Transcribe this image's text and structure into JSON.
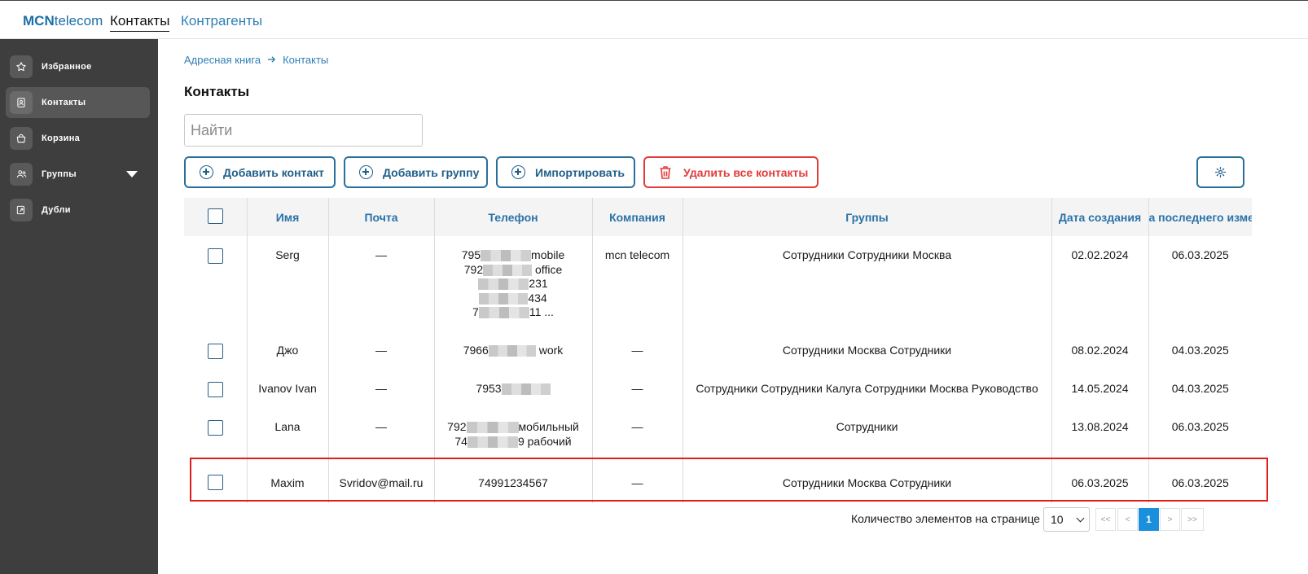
{
  "app": {
    "logo_bold": "MCN",
    "logo_rest": "telecom"
  },
  "topnav": [
    {
      "label": "Контакты",
      "active": true
    },
    {
      "label": "Контрагенты",
      "active": false
    }
  ],
  "sidebar": {
    "items": [
      {
        "label": "Избранное",
        "icon": "star-icon"
      },
      {
        "label": "Контакты",
        "icon": "contact-card-icon",
        "active": true
      },
      {
        "label": "Корзина",
        "icon": "basket-icon"
      },
      {
        "label": "Группы",
        "icon": "users-icon",
        "expandable": true
      },
      {
        "label": "Дубли",
        "icon": "duplicate-icon"
      }
    ]
  },
  "breadcrumb": [
    "Адресная книга",
    "Контакты"
  ],
  "page": {
    "title": "Контакты"
  },
  "search": {
    "placeholder": "Найти",
    "value": ""
  },
  "toolbar": {
    "add_contact": "Добавить контакт",
    "add_group": "Добавить группу",
    "import": "Импортировать",
    "delete_all": "Удалить все контакты"
  },
  "table": {
    "columns": [
      "Имя",
      "Почта",
      "Телефон",
      "Компания",
      "Группы",
      "Дата создания",
      "а последнего измен"
    ],
    "rows": [
      {
        "name": "Serg",
        "email": "—",
        "company": "mcn telecom",
        "groups": "Сотрудники Сотрудники Москва",
        "created": "02.02.2024",
        "modified": "06.03.2025",
        "phones": [
          {
            "pre": "795",
            "post": "mobile"
          },
          {
            "pre": "792",
            "post": " office"
          },
          {
            "pre": "",
            "post": "231"
          },
          {
            "pre": "",
            "post": "434"
          },
          {
            "pre": "7",
            "post": "11 ..."
          }
        ]
      },
      {
        "name": "Джо",
        "email": "—",
        "company": "—",
        "groups": "Сотрудники Москва Сотрудники",
        "created": "08.02.2024",
        "modified": "04.03.2025",
        "phones": [
          {
            "pre": "7966",
            "post": " work"
          }
        ]
      },
      {
        "name": "Ivanov Ivan",
        "email": "—",
        "company": "—",
        "groups": "Сотрудники Сотрудники Калуга Сотрудники Москва Руководство",
        "created": "14.05.2024",
        "modified": "04.03.2025",
        "phones": [
          {
            "pre": "7953",
            "post": ""
          }
        ]
      },
      {
        "name": "Lana",
        "email": "—",
        "company": "—",
        "groups": "Сотрудники",
        "created": "13.08.2024",
        "modified": "06.03.2025",
        "phones": [
          {
            "pre": "792",
            "post": "мобильный"
          },
          {
            "pre": "74",
            "post": "9 рабочий"
          }
        ]
      },
      {
        "name": "Maxim",
        "email": "Svridov@mail.ru",
        "company": "—",
        "groups": "Сотрудники Москва Сотрудники",
        "created": "06.03.2025",
        "modified": "06.03.2025",
        "phones": [
          {
            "pre": "74991234567",
            "post": ""
          }
        ]
      }
    ]
  },
  "pagination": {
    "label": "Количество элементов на странице",
    "page_size": "10",
    "first": "<<",
    "prev": "<",
    "current": "1",
    "next": ">",
    "last": ">>"
  },
  "colors": {
    "accent": "#2a72a8",
    "danger": "#e23b3b",
    "sidebar_bg": "#3e3e3e",
    "highlight": "#e21b1b"
  }
}
